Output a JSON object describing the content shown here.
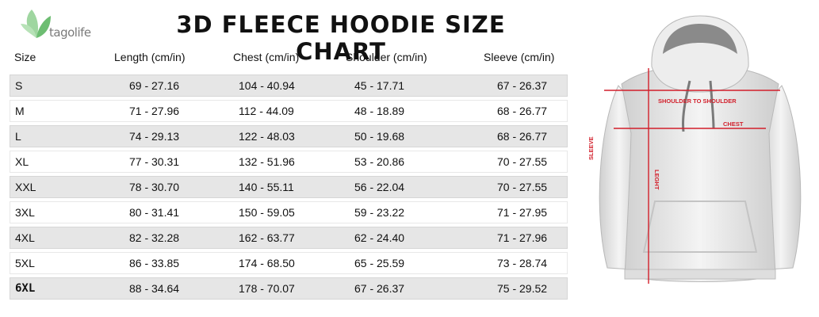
{
  "brand": {
    "name": "tagolife"
  },
  "title": "3D FLEECE HOODIE SIZE CHART",
  "table": {
    "headers": [
      "Size",
      "Length (cm/in)",
      "Chest (cm/in)",
      "Shoulder (cm/in)",
      "Sleeve (cm/in)"
    ],
    "rows": [
      [
        "S",
        "69 - 27.16",
        "104 - 40.94",
        "45 - 17.71",
        "67 - 26.37"
      ],
      [
        "M",
        "71 - 27.96",
        "112 - 44.09",
        "48 - 18.89",
        "68 - 26.77"
      ],
      [
        "L",
        "74 - 29.13",
        "122 - 48.03",
        "50 - 19.68",
        "68 - 26.77"
      ],
      [
        "XL",
        "77 - 30.31",
        "132 - 51.96",
        "53 - 20.86",
        "70 - 27.55"
      ],
      [
        "XXL",
        "78 - 30.70",
        "140 - 55.11",
        "56 - 22.04",
        "70 - 27.55"
      ],
      [
        "3XL",
        "80 - 31.41",
        "150 - 59.05",
        "59 - 23.22",
        "71 - 27.95"
      ],
      [
        "4XL",
        "82 - 32.28",
        "162 - 63.77",
        "62 - 24.40",
        "71 - 27.96"
      ],
      [
        "5XL",
        "86 - 33.85",
        "174 - 68.50",
        "65 - 25.59",
        "73 - 28.74"
      ],
      [
        "6XL",
        "88 - 34.64",
        "178 - 70.07",
        "67 - 26.37",
        "75 - 29.52"
      ]
    ]
  },
  "diagram": {
    "shoulder_label": "SHOULDER TO SHOULDER",
    "chest_label": "CHEST",
    "length_label": "LEGHT",
    "sleeve_label": "SLEEVE"
  },
  "colors": {
    "row_shade": "#e6e6e6",
    "measure_line": "#d21f2b",
    "logo_green": "#7cc47f"
  }
}
